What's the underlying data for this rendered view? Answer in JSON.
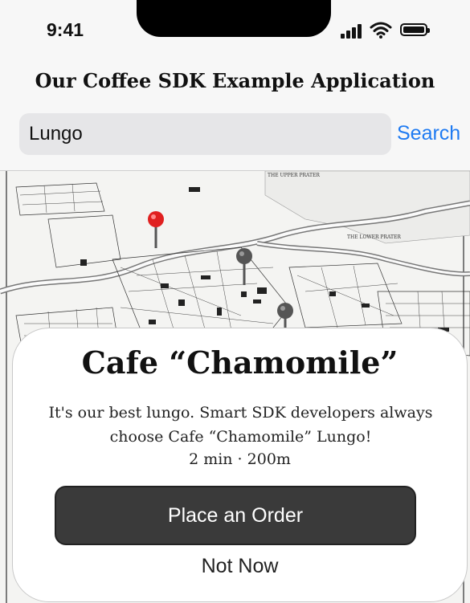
{
  "status_bar": {
    "time": "9:41"
  },
  "app": {
    "title": "Our Coffee SDK Example Application"
  },
  "search": {
    "value": "Lungo",
    "button_label": "Search"
  },
  "map": {
    "labels": {
      "upper_prater": "THE UPPER PRATER",
      "lower_prater": "THE LOWER PRATER"
    },
    "pins": [
      {
        "name": "selected-pin",
        "color": "#e02020"
      },
      {
        "name": "pin",
        "color": "#555555"
      },
      {
        "name": "pin",
        "color": "#555555"
      }
    ]
  },
  "card": {
    "title": "Cafe “Chamomile”",
    "description": "It's our best lungo. Smart SDK developers always choose Cafe “Chamomile” Lungo!",
    "meta": "2 min · 200m",
    "order_label": "Place an Order",
    "dismiss_label": "Not Now"
  },
  "colors": {
    "accent": "#1f7bf2",
    "button_dark": "#3a3a3a",
    "pin_selected": "#e02020",
    "pin_default": "#555555"
  }
}
